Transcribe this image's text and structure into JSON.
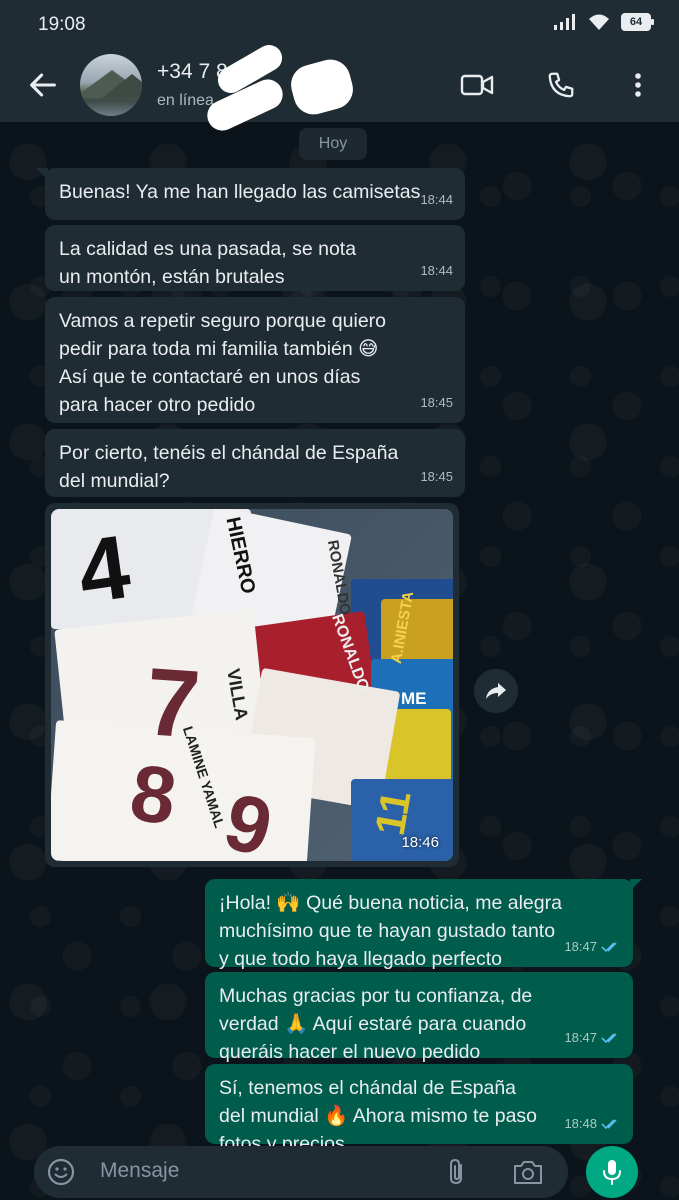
{
  "status_bar": {
    "time": "19:08",
    "battery": "64"
  },
  "header": {
    "contact_name": "+34  7    8 5",
    "contact_status": "en línea"
  },
  "date_chip": "Hoy",
  "messages_in": [
    {
      "text": "Buenas! Ya me han llegado las camisetas",
      "time": "18:44"
    },
    {
      "text": "La calidad es una pasada, se nota\nun montón, están brutales",
      "time": "18:44"
    },
    {
      "text": "Vamos a repetir seguro porque quiero\npedir para toda mi familia también 😅\nAsí que te contactaré en unos días\npara hacer otro pedido",
      "time": "18:45"
    },
    {
      "text": "Por cierto, tenéis el chándal de España\ndel mundial?",
      "time": "18:45"
    }
  ],
  "photo": {
    "time": "18:46",
    "visible_text": [
      "4",
      "HIERRO",
      "RONALDO",
      "A.INIESTA",
      "RONALDO",
      "ME",
      "VILLA",
      "7",
      "8",
      "9",
      "LAMINE YAMAL",
      "11"
    ]
  },
  "messages_out": [
    {
      "text": "¡Hola! 🙌 Qué buena noticia, me alegra\nmuchísimo que te hayan gustado tanto\ny que todo haya llegado perfecto",
      "time": "18:47"
    },
    {
      "text": "Muchas gracias por tu confianza, de\nverdad 🙏 Aquí estaré para cuando\nqueráis hacer el nuevo pedido",
      "time": "18:47"
    },
    {
      "text": "Sí, tenemos el chándal de España\ndel mundial 🔥 Ahora mismo te paso\nfotos y precios",
      "time": "18:48"
    }
  ],
  "input": {
    "placeholder": "Mensaje"
  },
  "colors": {
    "background": "#0b141a",
    "header": "#1f2c34",
    "incoming_bubble": "#202c33",
    "outgoing_bubble": "#005c4b",
    "accent": "#00a884",
    "read_ticks": "#53bdeb"
  },
  "icons": [
    "back-arrow-icon",
    "video-call-icon",
    "phone-icon",
    "more-vert-icon",
    "forward-icon",
    "emoji-icon",
    "attach-icon",
    "camera-icon",
    "mic-icon",
    "double-check-icon",
    "signal-icon",
    "wifi-icon",
    "battery-icon"
  ]
}
